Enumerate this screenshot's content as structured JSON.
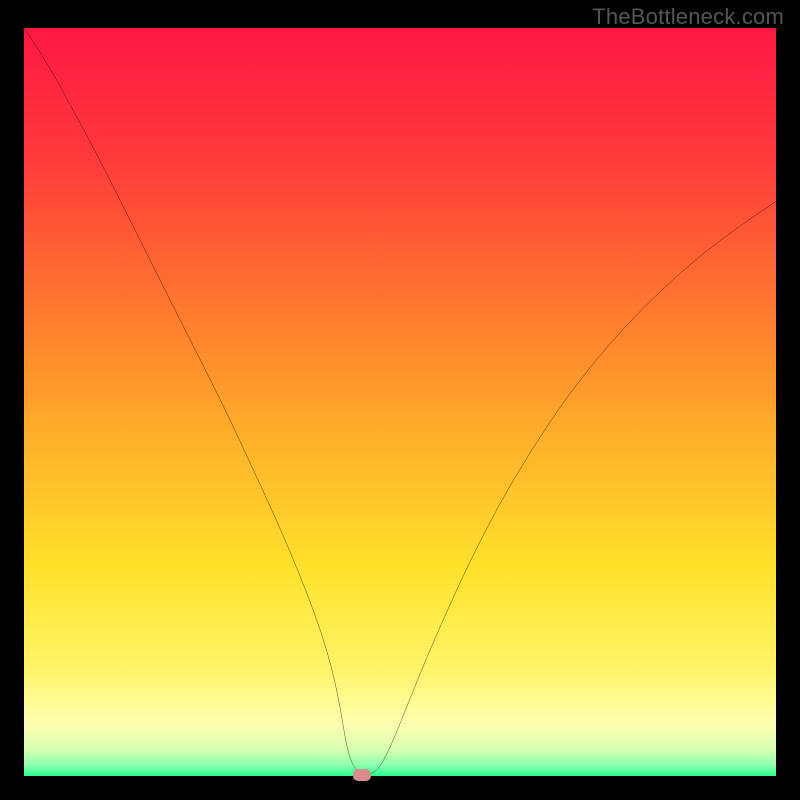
{
  "watermark": "TheBottleneck.com",
  "chart_data": {
    "type": "line",
    "title": "",
    "xlabel": "",
    "ylabel": "",
    "xlim": [
      0,
      100
    ],
    "ylim": [
      0,
      100
    ],
    "grid": false,
    "background": {
      "type": "vertical-gradient",
      "stops": [
        {
          "pos": 0.0,
          "color": "#ff1744"
        },
        {
          "pos": 0.18,
          "color": "#ff3b3b"
        },
        {
          "pos": 0.38,
          "color": "#ff7a2e"
        },
        {
          "pos": 0.55,
          "color": "#ffb02a"
        },
        {
          "pos": 0.72,
          "color": "#ffe12a"
        },
        {
          "pos": 0.86,
          "color": "#fff56a"
        },
        {
          "pos": 0.93,
          "color": "#ffffb0"
        },
        {
          "pos": 0.965,
          "color": "#d6ffb0"
        },
        {
          "pos": 0.985,
          "color": "#8fffb0"
        },
        {
          "pos": 1.0,
          "color": "#2aff8f"
        }
      ]
    },
    "series": [
      {
        "name": "bottleneck-curve",
        "color": "#000000",
        "width": 2,
        "x": [
          0.0,
          3.0,
          6.0,
          9.5,
          13.0,
          16.5,
          20.0,
          23.5,
          27.0,
          30.0,
          33.0,
          35.6,
          37.8,
          39.6,
          40.9,
          41.8,
          42.4,
          42.9,
          43.6,
          44.6,
          45.8,
          46.8,
          47.8,
          49.2,
          51.0,
          53.2,
          56.0,
          59.2,
          63.0,
          67.4,
          72.4,
          78.0,
          84.2,
          91.0,
          98.0,
          100.0
        ],
        "y": [
          100.0,
          95.5,
          90.0,
          83.5,
          76.5,
          69.5,
          62.5,
          55.5,
          48.5,
          42.0,
          35.5,
          29.5,
          24.0,
          19.0,
          14.5,
          10.5,
          7.0,
          4.0,
          1.6,
          0.4,
          0.2,
          0.6,
          2.0,
          5.0,
          9.5,
          15.0,
          21.5,
          28.5,
          36.0,
          43.5,
          51.0,
          58.0,
          64.5,
          70.5,
          75.5,
          76.8
        ]
      }
    ],
    "annotations": [
      {
        "name": "optimum-marker",
        "x": 45.0,
        "y": 0.2,
        "color": "#d98a8a",
        "shape": "rounded-rect"
      }
    ]
  }
}
